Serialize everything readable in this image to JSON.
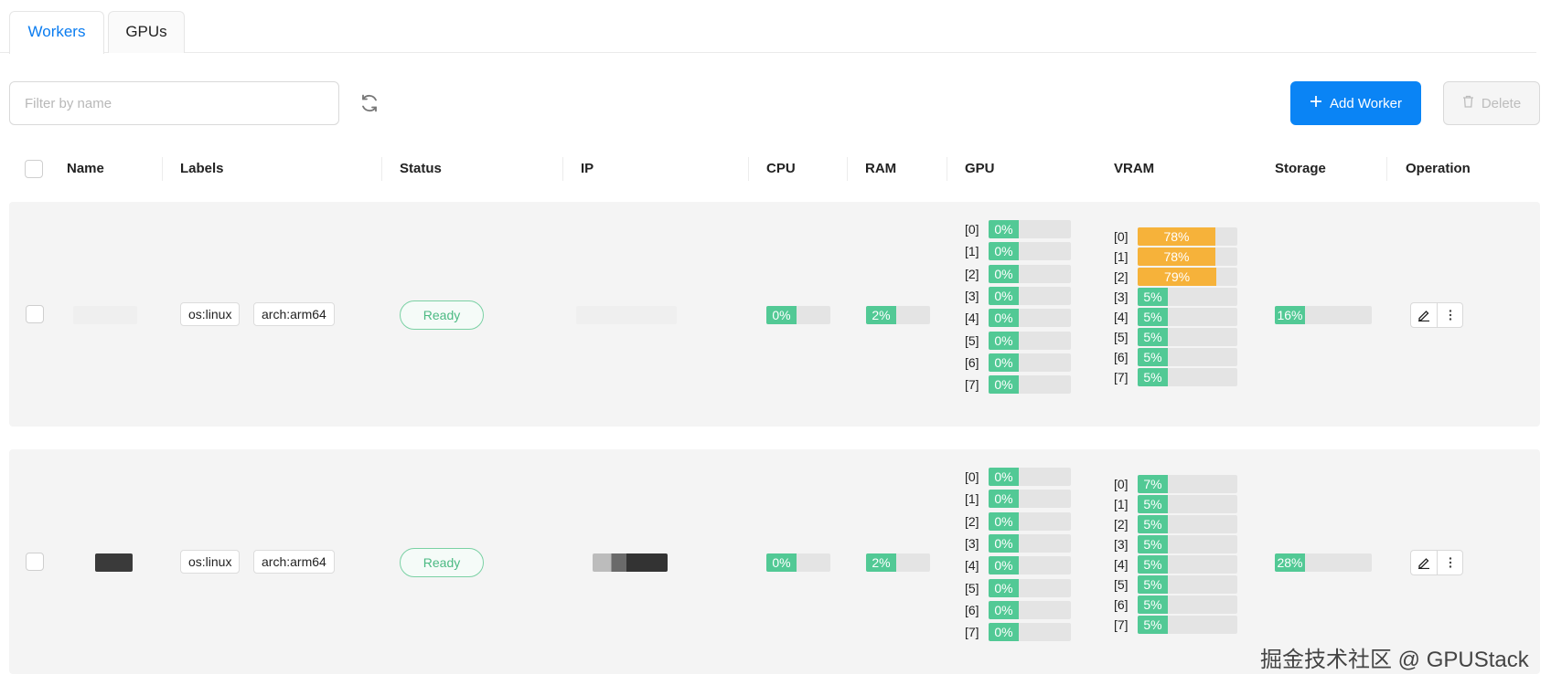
{
  "tabs": [
    {
      "label": "Workers",
      "active": true
    },
    {
      "label": "GPUs",
      "active": false
    }
  ],
  "toolbar": {
    "filter_placeholder": "Filter by name",
    "add_label": "Add Worker",
    "delete_label": "Delete"
  },
  "columns": {
    "name": "Name",
    "labels": "Labels",
    "status": "Status",
    "ip": "IP",
    "cpu": "CPU",
    "ram": "RAM",
    "gpu": "GPU",
    "vram": "VRAM",
    "storage": "Storage",
    "operation": "Operation"
  },
  "workers": [
    {
      "labels": [
        "os:linux",
        "arch:arm64"
      ],
      "status": "Ready",
      "cpu": "0%",
      "ram": "2%",
      "gpu": [
        {
          "idx": "[0]",
          "val": "0%"
        },
        {
          "idx": "[1]",
          "val": "0%"
        },
        {
          "idx": "[2]",
          "val": "0%"
        },
        {
          "idx": "[3]",
          "val": "0%"
        },
        {
          "idx": "[4]",
          "val": "0%"
        },
        {
          "idx": "[5]",
          "val": "0%"
        },
        {
          "idx": "[6]",
          "val": "0%"
        },
        {
          "idx": "[7]",
          "val": "0%"
        }
      ],
      "vram": [
        {
          "idx": "[0]",
          "val": "78%"
        },
        {
          "idx": "[1]",
          "val": "78%"
        },
        {
          "idx": "[2]",
          "val": "79%"
        },
        {
          "idx": "[3]",
          "val": "5%"
        },
        {
          "idx": "[4]",
          "val": "5%"
        },
        {
          "idx": "[5]",
          "val": "5%"
        },
        {
          "idx": "[6]",
          "val": "5%"
        },
        {
          "idx": "[7]",
          "val": "5%"
        }
      ],
      "storage": "16%"
    },
    {
      "labels": [
        "os:linux",
        "arch:arm64"
      ],
      "status": "Ready",
      "cpu": "0%",
      "ram": "2%",
      "gpu": [
        {
          "idx": "[0]",
          "val": "0%"
        },
        {
          "idx": "[1]",
          "val": "0%"
        },
        {
          "idx": "[2]",
          "val": "0%"
        },
        {
          "idx": "[3]",
          "val": "0%"
        },
        {
          "idx": "[4]",
          "val": "0%"
        },
        {
          "idx": "[5]",
          "val": "0%"
        },
        {
          "idx": "[6]",
          "val": "0%"
        },
        {
          "idx": "[7]",
          "val": "0%"
        }
      ],
      "vram": [
        {
          "idx": "[0]",
          "val": "7%"
        },
        {
          "idx": "[1]",
          "val": "5%"
        },
        {
          "idx": "[2]",
          "val": "5%"
        },
        {
          "idx": "[3]",
          "val": "5%"
        },
        {
          "idx": "[4]",
          "val": "5%"
        },
        {
          "idx": "[5]",
          "val": "5%"
        },
        {
          "idx": "[6]",
          "val": "5%"
        },
        {
          "idx": "[7]",
          "val": "5%"
        }
      ],
      "storage": "28%"
    }
  ],
  "icons": {
    "refresh": "refresh-icon",
    "add": "plus-icon",
    "delete": "trash-icon",
    "edit": "edit-icon",
    "more": "more-vertical-icon"
  },
  "colors": {
    "accent": "#0a84f5",
    "usage_ok": "#52c995",
    "usage_warn": "#f6b23a",
    "status_ready": "#4cba83"
  },
  "watermark": "掘金技术社区 @ GPUStack"
}
